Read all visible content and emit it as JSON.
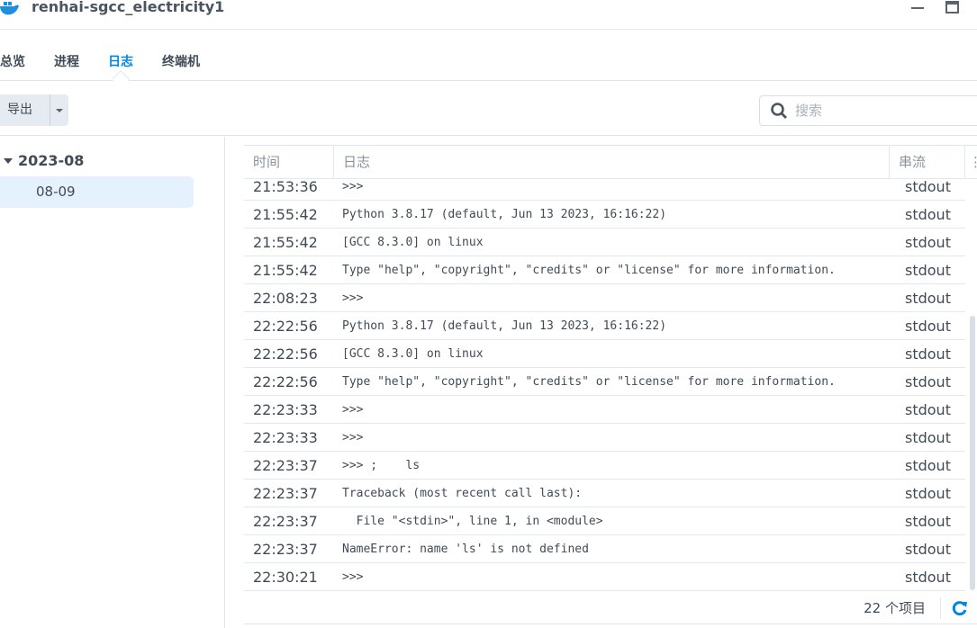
{
  "window": {
    "title": "renhai-sgcc_electricity1"
  },
  "tabs": [
    {
      "label": "总览"
    },
    {
      "label": "进程"
    },
    {
      "label": "日志",
      "active": true
    },
    {
      "label": "终端机"
    }
  ],
  "toolbar": {
    "export_label": "导出",
    "search_placeholder": "搜索"
  },
  "sidebar": {
    "month": "2023-08",
    "days": [
      {
        "label": "08-09",
        "selected": true
      }
    ]
  },
  "grid": {
    "columns": [
      "时间",
      "日志",
      "串流"
    ],
    "rows": [
      {
        "time": "21:53:36",
        "log": ">>>",
        "stream": "stdout"
      },
      {
        "time": "21:55:42",
        "log": "Python 3.8.17 (default, Jun 13 2023, 16:16:22)",
        "stream": "stdout"
      },
      {
        "time": "21:55:42",
        "log": "[GCC 8.3.0] on linux",
        "stream": "stdout"
      },
      {
        "time": "21:55:42",
        "log": "Type \"help\", \"copyright\", \"credits\" or \"license\" for more information.",
        "stream": "stdout"
      },
      {
        "time": "22:08:23",
        "log": ">>>",
        "stream": "stdout"
      },
      {
        "time": "22:22:56",
        "log": "Python 3.8.17 (default, Jun 13 2023, 16:16:22)",
        "stream": "stdout"
      },
      {
        "time": "22:22:56",
        "log": "[GCC 8.3.0] on linux",
        "stream": "stdout"
      },
      {
        "time": "22:22:56",
        "log": "Type \"help\", \"copyright\", \"credits\" or \"license\" for more information.",
        "stream": "stdout"
      },
      {
        "time": "22:23:33",
        "log": ">>>",
        "stream": "stdout"
      },
      {
        "time": "22:23:33",
        "log": ">>>",
        "stream": "stdout"
      },
      {
        "time": "22:23:37",
        "log": ">>> ;    ls",
        "stream": "stdout"
      },
      {
        "time": "22:23:37",
        "log": "Traceback (most recent call last):",
        "stream": "stdout"
      },
      {
        "time": "22:23:37",
        "log": "  File \"<stdin>\", line 1, in <module>",
        "stream": "stdout"
      },
      {
        "time": "22:23:37",
        "log": "NameError: name 'ls' is not defined",
        "stream": "stdout"
      },
      {
        "time": "22:30:21",
        "log": ">>>",
        "stream": "stdout"
      }
    ],
    "count_label": "22 个项目"
  },
  "colors": {
    "accent": "#0086e5",
    "selected_bg": "#e5f1fd",
    "button_bg": "#e6ebf2"
  }
}
